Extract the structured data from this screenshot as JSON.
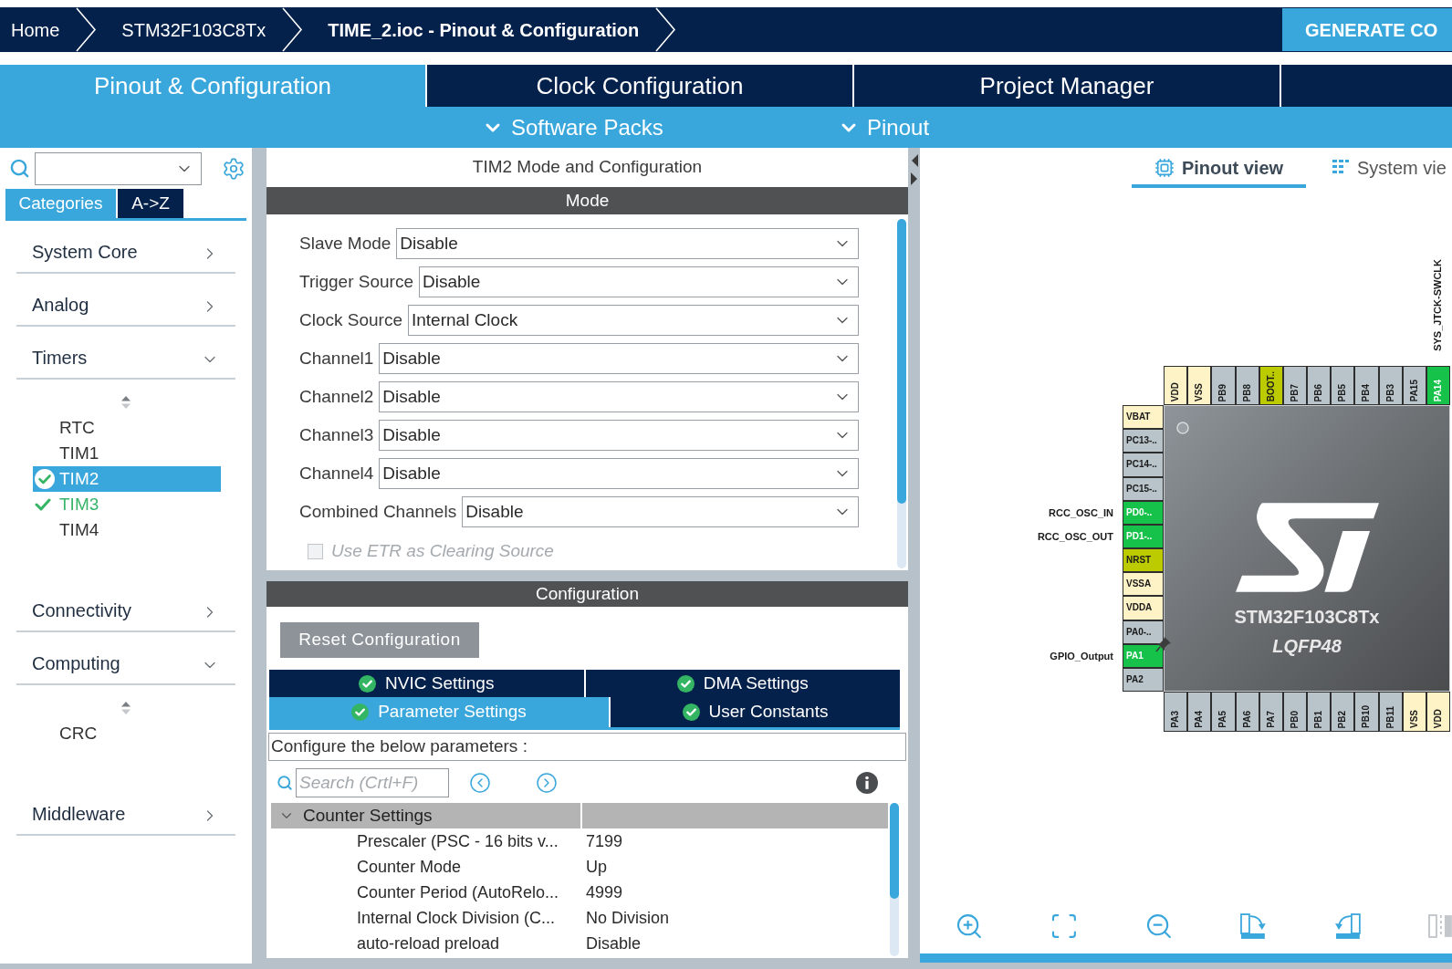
{
  "breadcrumb": [
    {
      "label": "Home",
      "current": false
    },
    {
      "label": "STM32F103C8Tx",
      "current": false
    },
    {
      "label": "TIME_2.ioc - Pinout & Configuration",
      "current": true
    }
  ],
  "generate_button": {
    "label": "GENERATE CO"
  },
  "main_tabs": [
    {
      "label": "Pinout & Configuration",
      "selected": true
    },
    {
      "label": "Clock Configuration",
      "selected": false
    },
    {
      "label": "Project Manager",
      "selected": false
    }
  ],
  "sub_menus": [
    {
      "label": "Software Packs"
    },
    {
      "label": "Pinout"
    }
  ],
  "sidebar": {
    "tabs": [
      {
        "label": "Categories",
        "selected": true
      },
      {
        "label": "A->Z",
        "selected": false
      }
    ],
    "categories": [
      {
        "label": "System Core",
        "expanded": false
      },
      {
        "label": "Analog",
        "expanded": false
      },
      {
        "label": "Timers",
        "expanded": true,
        "children": [
          {
            "label": "RTC",
            "selected": false,
            "configured": false
          },
          {
            "label": "TIM1",
            "selected": false,
            "configured": false
          },
          {
            "label": "TIM2",
            "selected": true,
            "configured": true
          },
          {
            "label": "TIM3",
            "selected": false,
            "configured": true
          },
          {
            "label": "TIM4",
            "selected": false,
            "configured": false
          }
        ]
      },
      {
        "label": "Connectivity",
        "expanded": false
      },
      {
        "label": "Computing",
        "expanded": true,
        "children": [
          {
            "label": "CRC",
            "selected": false,
            "configured": false
          }
        ]
      },
      {
        "label": "Middleware",
        "expanded": false
      }
    ]
  },
  "mode_panel": {
    "title": "TIM2 Mode and Configuration",
    "header": "Mode",
    "fields": [
      {
        "label": "Slave Mode",
        "value": "Disable"
      },
      {
        "label": "Trigger Source",
        "value": "Disable"
      },
      {
        "label": "Clock Source",
        "value": "Internal Clock"
      },
      {
        "label": "Channel1",
        "value": "Disable"
      },
      {
        "label": "Channel2",
        "value": "Disable"
      },
      {
        "label": "Channel3",
        "value": "Disable"
      },
      {
        "label": "Channel4",
        "value": "Disable"
      },
      {
        "label": "Combined Channels",
        "value": "Disable"
      }
    ],
    "etr_option": {
      "label": "Use ETR as Clearing Source",
      "checked": false,
      "disabled": true
    }
  },
  "configuration": {
    "header": "Configuration",
    "reset_button": {
      "label": "Reset Configuration"
    },
    "tabs": [
      {
        "label": "NVIC Settings",
        "selected": false,
        "valid": true
      },
      {
        "label": "DMA Settings",
        "selected": false,
        "valid": true
      },
      {
        "label": "Parameter Settings",
        "selected": true,
        "valid": true
      },
      {
        "label": "User Constants",
        "selected": false,
        "valid": true
      }
    ],
    "description": "Configure the below parameters :",
    "search": {
      "placeholder": "Search (Crtl+F)"
    },
    "groups": [
      {
        "label": "Counter Settings",
        "expanded": true,
        "rows": [
          {
            "name": "Prescaler (PSC - 16 bits v...",
            "value": "7199"
          },
          {
            "name": "Counter Mode",
            "value": "Up"
          },
          {
            "name": "Counter Period (AutoRelo...",
            "value": "4999"
          },
          {
            "name": "Internal Clock Division (C...",
            "value": "No Division"
          },
          {
            "name": "auto-reload preload",
            "value": "Disable"
          }
        ]
      }
    ]
  },
  "pinout": {
    "tabs": [
      {
        "label": "Pinout view",
        "selected": true
      },
      {
        "label": "System vie",
        "selected": false
      }
    ],
    "chip": {
      "name": "STM32F103C8Tx",
      "package": "LQFP48",
      "pins_top": [
        {
          "label": "VDD",
          "kind": "power"
        },
        {
          "label": "VSS",
          "kind": "power"
        },
        {
          "label": "PB9",
          "kind": "free"
        },
        {
          "label": "PB8",
          "kind": "free"
        },
        {
          "label": "BOOT..",
          "kind": "fixed"
        },
        {
          "label": "PB7",
          "kind": "free"
        },
        {
          "label": "PB6",
          "kind": "free"
        },
        {
          "label": "PB5",
          "kind": "free"
        },
        {
          "label": "PB4",
          "kind": "free"
        },
        {
          "label": "PB3",
          "kind": "free"
        },
        {
          "label": "PA15",
          "kind": "free"
        },
        {
          "label": "PA14",
          "kind": "assigned",
          "signal": "SYS_JTCK-SWCLK"
        }
      ],
      "pins_left": [
        {
          "label": "VBAT",
          "kind": "power",
          "pinned": false
        },
        {
          "label": "PC13-..",
          "kind": "free",
          "pinned": false
        },
        {
          "label": "PC14-..",
          "kind": "free",
          "pinned": false
        },
        {
          "label": "PC15-..",
          "kind": "free",
          "pinned": false
        },
        {
          "label": "PD0-..",
          "kind": "assigned",
          "signal": "RCC_OSC_IN",
          "pinned": false
        },
        {
          "label": "PD1-..",
          "kind": "assigned",
          "signal": "RCC_OSC_OUT",
          "pinned": false
        },
        {
          "label": "NRST",
          "kind": "fixed",
          "pinned": false
        },
        {
          "label": "VSSA",
          "kind": "power",
          "pinned": false
        },
        {
          "label": "VDDA",
          "kind": "power",
          "pinned": false
        },
        {
          "label": "PA0-..",
          "kind": "free",
          "pinned": false
        },
        {
          "label": "PA1",
          "kind": "assigned",
          "signal": "GPIO_Output",
          "pinned": true
        },
        {
          "label": "PA2",
          "kind": "free",
          "pinned": false
        }
      ],
      "pins_bottom": [
        {
          "label": "PA3",
          "kind": "free"
        },
        {
          "label": "PA4",
          "kind": "free"
        },
        {
          "label": "PA5",
          "kind": "free"
        },
        {
          "label": "PA6",
          "kind": "free"
        },
        {
          "label": "PA7",
          "kind": "free"
        },
        {
          "label": "PB0",
          "kind": "free"
        },
        {
          "label": "PB1",
          "kind": "free"
        },
        {
          "label": "PB2",
          "kind": "free"
        },
        {
          "label": "PB10",
          "kind": "free"
        },
        {
          "label": "PB11",
          "kind": "free"
        },
        {
          "label": "VSS",
          "kind": "power"
        },
        {
          "label": "VDD",
          "kind": "power"
        }
      ]
    }
  }
}
